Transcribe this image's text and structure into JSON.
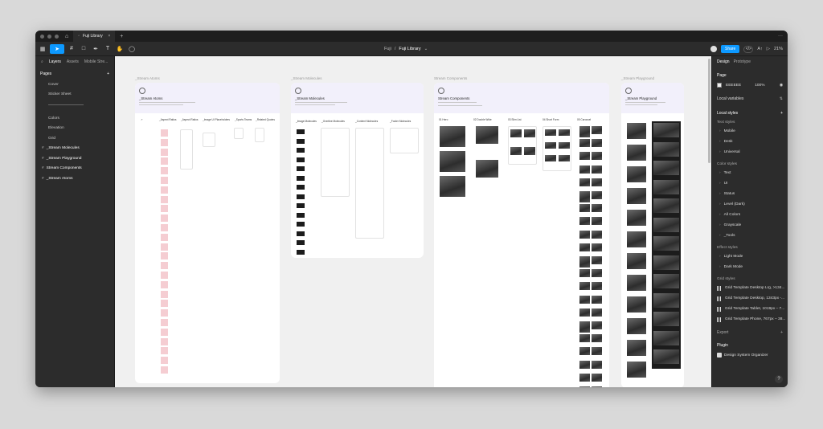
{
  "titlebar": {
    "tab_title": "Fuji Library",
    "tab_close": "×",
    "new_tab": "+",
    "more": "···"
  },
  "toolbar": {
    "breadcrumb_team": "Fuji",
    "breadcrumb_sep": "/",
    "file_name": "Fuji Library",
    "file_chevron": "⌄",
    "share_label": "Share",
    "code_label": "</>",
    "play": "▷",
    "aa": "A↑",
    "zoom": "21%"
  },
  "left_panel": {
    "tabs": [
      "Layers",
      "Assets",
      "Mobile Stre..."
    ],
    "pages_title": "Pages",
    "add": "+",
    "pages": [
      "Cover",
      "Sticker Sheet",
      "Colors",
      "Elevation",
      "Grid"
    ],
    "layers": [
      "_Stream Molecules",
      "_Stream Playground",
      "Stream Components",
      "_Stream Atoms"
    ]
  },
  "canvas": {
    "frames": [
      {
        "label": "_Stream Atoms",
        "title": "_Stream Atoms",
        "columns": [
          "",
          "_Aspect Ratios",
          "_Aspect Ratios",
          "_Image UI Placeholders",
          "_Sports Teams",
          "_Related Quotes"
        ]
      },
      {
        "label": "_Stream Molecules",
        "title": "_Stream Molecules",
        "columns": [
          "_Image Molecules",
          "_Overline Molecules",
          "_Content Molecules",
          "_Footer Molecules"
        ]
      },
      {
        "label": "Stream Components",
        "title": "Stream Components",
        "columns": [
          "01 Hero",
          "02 Double Wide",
          "03 Slim List",
          "04 Short Form",
          "05 Carousel"
        ]
      },
      {
        "label": "_Stream Playground",
        "title": "_Stream Playground",
        "columns": []
      }
    ]
  },
  "right_panel": {
    "tabs": [
      "Design",
      "Prototype"
    ],
    "page_title": "Page",
    "page_fill_hex": "EEEEEE",
    "page_fill_opacity": "100%",
    "local_variables": "Local variables",
    "local_styles": "Local styles",
    "text_styles_title": "Text styles",
    "text_styles": [
      "Mobile",
      "Desk",
      "Universal"
    ],
    "color_styles_title": "Color styles",
    "color_styles": [
      "Text",
      "UI",
      "Status",
      "Level (Dark)",
      "All Colors",
      "Grayscale",
      "_Tools"
    ],
    "effect_styles_title": "Effect styles",
    "effect_styles": [
      "Light Mode",
      "Dark Mode"
    ],
    "grid_styles_title": "Grid styles",
    "grid_styles": [
      "Grid Template Desktop Lrg, >134...",
      "Grid Template Desktop, 1343px -...",
      "Grid Template Tablet, 1019px – 7...",
      "Grid Template Phone, 767px – 38..."
    ],
    "export_title": "Export",
    "plugin_title": "Plugin",
    "plugin_name": "Design System Organizer",
    "help": "?"
  },
  "colors": {
    "accent": "#0d99ff",
    "ui_dark": "#2c2c2c",
    "canvas_bg": "#f0f0f0",
    "frame_header": "#f2f0fb"
  }
}
